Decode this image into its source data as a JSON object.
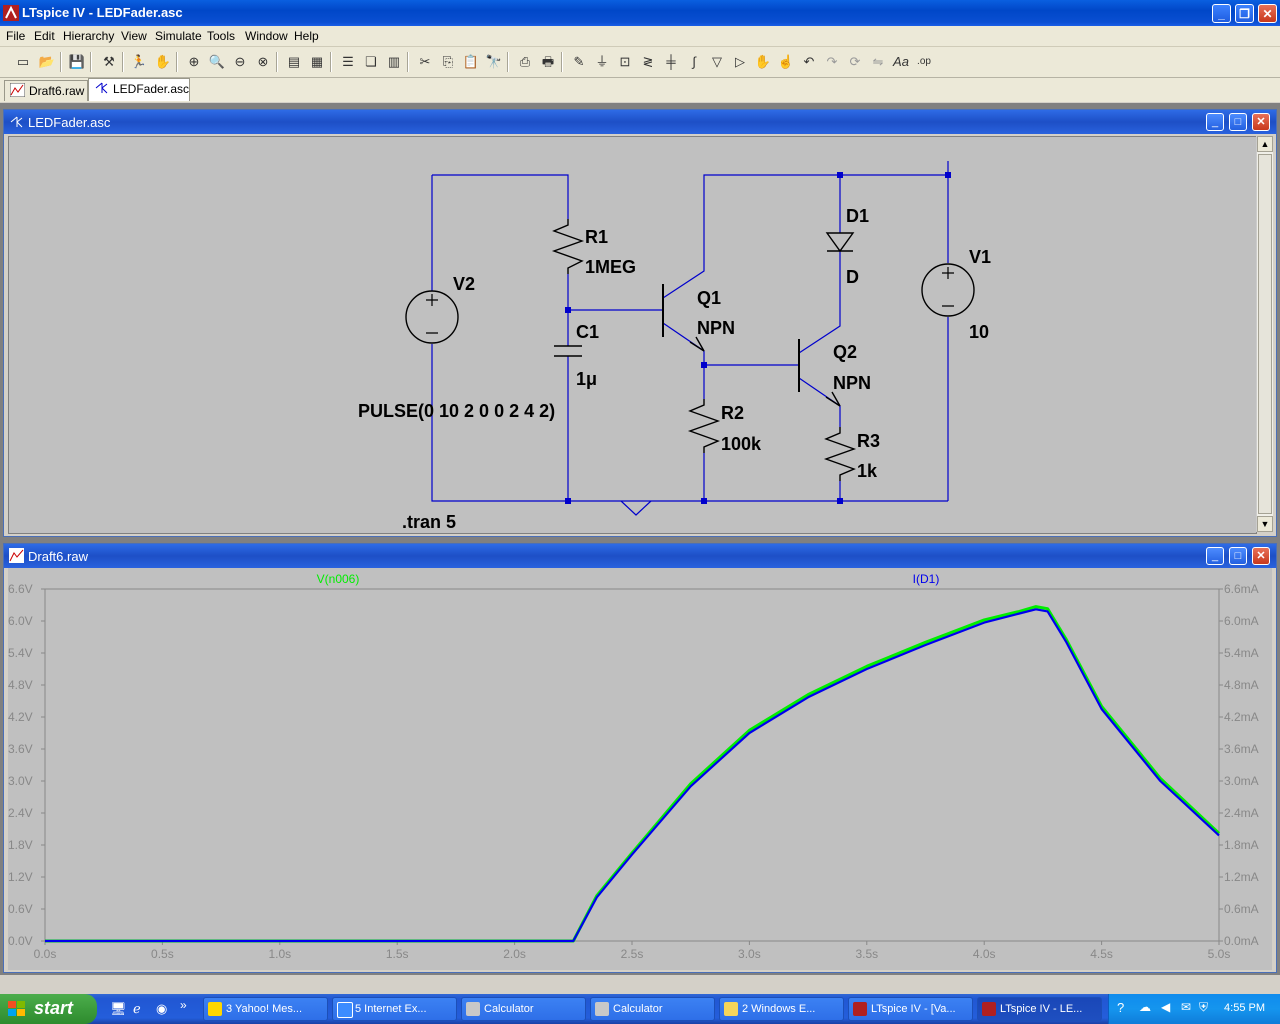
{
  "window": {
    "title": "LTspice IV - LEDFader.asc"
  },
  "menu": [
    "File",
    "Edit",
    "Hierarchy",
    "View",
    "Simulate",
    "Tools",
    "Window",
    "Help"
  ],
  "tabs": [
    {
      "label": "Draft6.raw",
      "active": false
    },
    {
      "label": "LEDFader.asc",
      "active": true
    }
  ],
  "schematic_window": {
    "title": "LEDFader.asc"
  },
  "plot_window": {
    "title": "Draft6.raw"
  },
  "schematic": {
    "components": {
      "r1": {
        "name": "R1",
        "value": "1MEG"
      },
      "c1": {
        "name": "C1",
        "value": "1μ"
      },
      "q1": {
        "name": "Q1",
        "value": "NPN"
      },
      "q2": {
        "name": "Q2",
        "value": "NPN"
      },
      "r2": {
        "name": "R2",
        "value": "100k"
      },
      "r3": {
        "name": "R3",
        "value": "1k"
      },
      "d1": {
        "name": "D1",
        "value": "D"
      },
      "v1": {
        "name": "V1",
        "value": "10"
      },
      "v2": {
        "name": "V2",
        "value": "PULSE(0 10 2 0 0 2 4 2)"
      }
    },
    "directive": ".tran 5"
  },
  "chart_data": {
    "type": "line",
    "xlabel": "",
    "x_ticks": [
      "0.0s",
      "0.5s",
      "1.0s",
      "1.5s",
      "2.0s",
      "2.5s",
      "3.0s",
      "3.5s",
      "4.0s",
      "4.5s",
      "5.0s"
    ],
    "y_left_ticks": [
      "0.0V",
      "0.6V",
      "1.2V",
      "1.8V",
      "2.4V",
      "3.0V",
      "3.6V",
      "4.2V",
      "4.8V",
      "5.4V",
      "6.0V",
      "6.6V"
    ],
    "y_right_ticks": [
      "0.0mA",
      "0.6mA",
      "1.2mA",
      "1.8mA",
      "2.4mA",
      "3.0mA",
      "3.6mA",
      "4.2mA",
      "4.8mA",
      "5.4mA",
      "6.0mA",
      "6.6mA"
    ],
    "xlim": [
      0,
      5
    ],
    "ylim_left": [
      0,
      6.6
    ],
    "ylim_right": [
      0,
      6.6
    ],
    "grid": false,
    "series": [
      {
        "name": "V(n006)",
        "axis": "left",
        "color": "#00ee00",
        "x": [
          0,
          2.0,
          2.25,
          2.35,
          2.5,
          2.75,
          3.0,
          3.25,
          3.5,
          3.75,
          4.0,
          4.15,
          4.22,
          4.27,
          4.35,
          4.5,
          4.75,
          5.0
        ],
        "y": [
          0,
          0,
          0,
          0.85,
          1.65,
          2.95,
          3.95,
          4.62,
          5.15,
          5.6,
          6.02,
          6.18,
          6.27,
          6.23,
          5.65,
          4.4,
          3.05,
          2.02
        ]
      },
      {
        "name": "I(D1)",
        "axis": "right",
        "color": "#0000ee",
        "x": [
          0,
          2.0,
          2.25,
          2.35,
          2.5,
          2.75,
          3.0,
          3.25,
          3.5,
          3.75,
          4.0,
          4.15,
          4.22,
          4.27,
          4.35,
          4.5,
          4.75,
          5.0
        ],
        "y": [
          0,
          0,
          0,
          0.82,
          1.62,
          2.9,
          3.9,
          4.57,
          5.1,
          5.55,
          5.97,
          6.14,
          6.22,
          6.18,
          5.6,
          4.35,
          3.0,
          1.98
        ]
      }
    ]
  },
  "taskbar": {
    "start_label": "start",
    "tasks": [
      {
        "label": "3 Yahoo! Mes...",
        "active": false
      },
      {
        "label": "5 Internet Ex...",
        "active": false
      },
      {
        "label": "Calculator",
        "active": false
      },
      {
        "label": "Calculator",
        "active": false
      },
      {
        "label": "2 Windows E...",
        "active": false
      },
      {
        "label": "LTspice IV - [Va...",
        "active": false
      },
      {
        "label": "LTspice IV - LE...",
        "active": true
      }
    ],
    "clock": "4:55 PM"
  }
}
